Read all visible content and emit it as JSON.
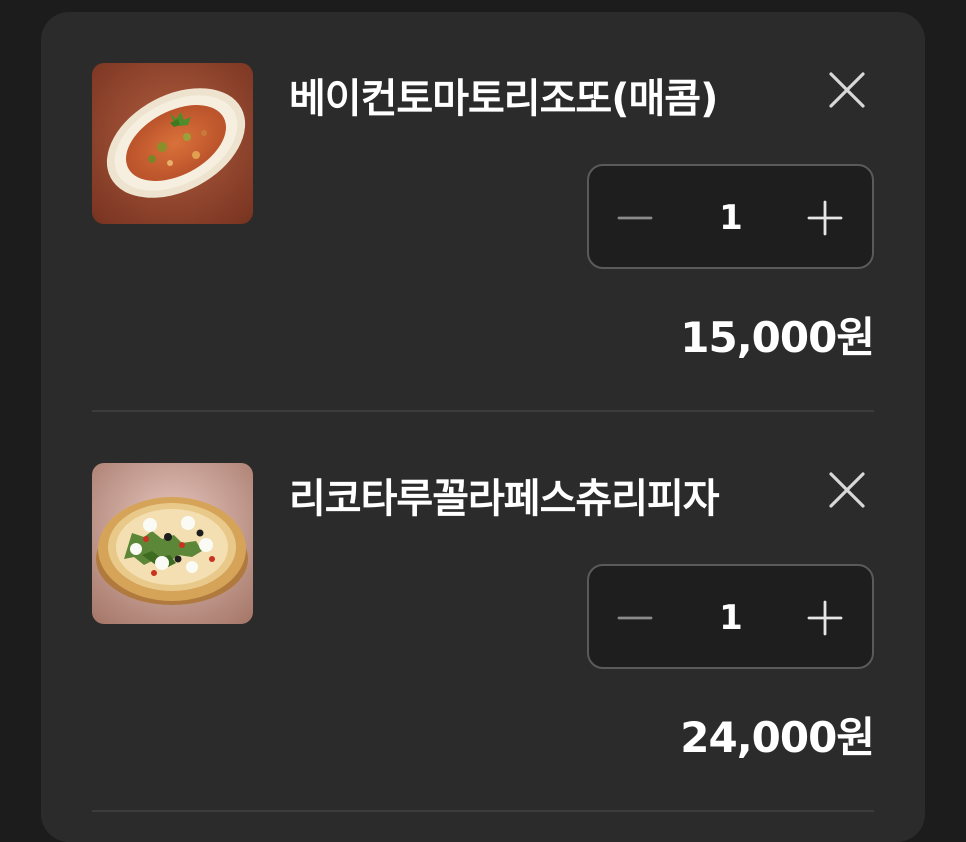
{
  "cart": {
    "items": [
      {
        "name": "베이컨토마토리조또(매콤)",
        "quantity": "1",
        "price": "15,000원",
        "image_icon": "risotto-dish-image"
      },
      {
        "name": "리코타루꼴라페스츄리피자",
        "quantity": "1",
        "price": "24,000원",
        "image_icon": "pizza-image"
      }
    ]
  },
  "colors": {
    "background": "#1c1c1c",
    "panel": "#2b2b2b",
    "stepper_bg": "#1e1e1e",
    "stepper_border": "#5a5a5a",
    "text": "#ffffff",
    "icon_muted": "#8a8a8a",
    "icon": "#d8d8d8",
    "divider": "#3c3c3c"
  }
}
